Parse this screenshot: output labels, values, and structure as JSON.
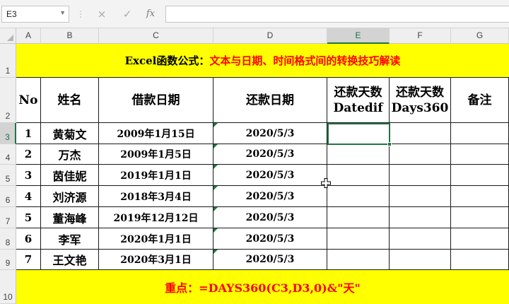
{
  "formula_bar": {
    "name_box": "E3",
    "name_box_dropdown_icon": "dropdown-arrow-icon",
    "cancel_icon": "×",
    "enter_icon": "✓",
    "fx_label": "fx",
    "formula": ""
  },
  "columns": [
    "A",
    "B",
    "C",
    "D",
    "E",
    "F",
    "G"
  ],
  "selected_column": "E",
  "rows": [
    "1",
    "2",
    "3",
    "4",
    "5",
    "6",
    "7",
    "8",
    "9",
    "10"
  ],
  "selected_row": "3",
  "title": {
    "black_part": "Excel函数公式：",
    "red_part": "文本与日期、时间格式间的转换技巧解读"
  },
  "table_headers": {
    "no": "No",
    "name": "姓名",
    "loan_date": "借款日期",
    "repay_date": "还款日期",
    "days_datedif_line1": "还款天数",
    "days_datedif_line2": "Datedif",
    "days_360_line1": "还款天数",
    "days_360_line2": "Days360",
    "remarks": "备注"
  },
  "table_rows": [
    {
      "no": "1",
      "name": "黄菊文",
      "loan_date": "2009年1月15日",
      "repay_date": "2020/5/3"
    },
    {
      "no": "2",
      "name": "万杰",
      "loan_date": "2009年1月5日",
      "repay_date": "2020/5/3"
    },
    {
      "no": "3",
      "name": "茵佳妮",
      "loan_date": "2019年1月1日",
      "repay_date": "2020/5/3"
    },
    {
      "no": "4",
      "name": "刘济源",
      "loan_date": "2018年3月4日",
      "repay_date": "2020/5/3"
    },
    {
      "no": "5",
      "name": "董海峰",
      "loan_date": "2019年12月12日",
      "repay_date": "2020/5/3"
    },
    {
      "no": "6",
      "name": "李军",
      "loan_date": "2020年1月1日",
      "repay_date": "2020/5/3"
    },
    {
      "no": "7",
      "name": "王文艳",
      "loan_date": "2020年3月1日",
      "repay_date": "2020/5/3"
    }
  ],
  "footer": {
    "text": "重点：=DAYS360(C3,D3,0)&\"天\""
  },
  "colors": {
    "highlight": "#ffff00",
    "title_red": "#ff0000",
    "selection_green": "#217346"
  }
}
